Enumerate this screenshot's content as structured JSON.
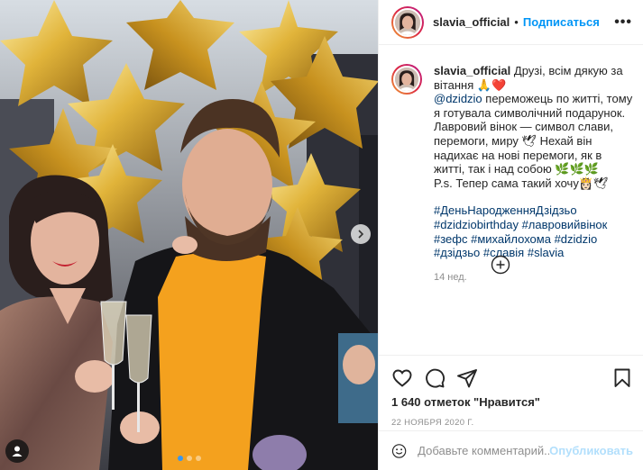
{
  "post": {
    "username": "slavia_official",
    "separator": "•",
    "follow_label": "Подписаться",
    "more_label": "•••"
  },
  "caption": {
    "username": "slavia_official",
    "line1": "Друзі, всім дякую за вітання 🙏❤️",
    "mention": "@dzidzio",
    "line2": " переможець по житті, тому я готувала символічний подарунок. Лавровий вінок — символ слави, перемоги, миру 🕊 Нехай він надихає на нові перемоги, як в житті, так і над собою 🌿🌿🌿",
    "line3": "P.s. Тепер сама такий хочу👸🏻🕊",
    "hashtags": [
      "#ДеньНародженняДзідзьо",
      "#dzidziobirthday",
      "#лавровийвінок",
      "#зефс",
      "#михайлохома",
      "#dzidzio",
      "#дзідзьо",
      "#славія",
      "#slavia"
    ],
    "time": "14 нед."
  },
  "actions": {
    "likes": "1 640 отметок \"Нравится\"",
    "date": "22 НОЯБРЯ 2020 Г."
  },
  "comment_box": {
    "placeholder": "Добавьте комментарий...",
    "publish_label": "Опубликовать"
  },
  "carousel": {
    "total_slides": 3,
    "current_slide": 1
  },
  "colors": {
    "link_blue": "#0095f6",
    "tag_navy": "#00376b",
    "muted": "#8e8e8e",
    "active_dot": "#3897f0",
    "shirt": "#f4a11e",
    "balloon_gold": "#d9a92a"
  },
  "icons": {
    "heart": "heart-icon",
    "comment": "comment-icon",
    "share": "share-icon",
    "save": "bookmark-icon",
    "emoji": "emoji-icon",
    "load_more": "plus-circle-icon",
    "next": "chevron-right-icon",
    "user_tag": "user-tag-icon"
  }
}
